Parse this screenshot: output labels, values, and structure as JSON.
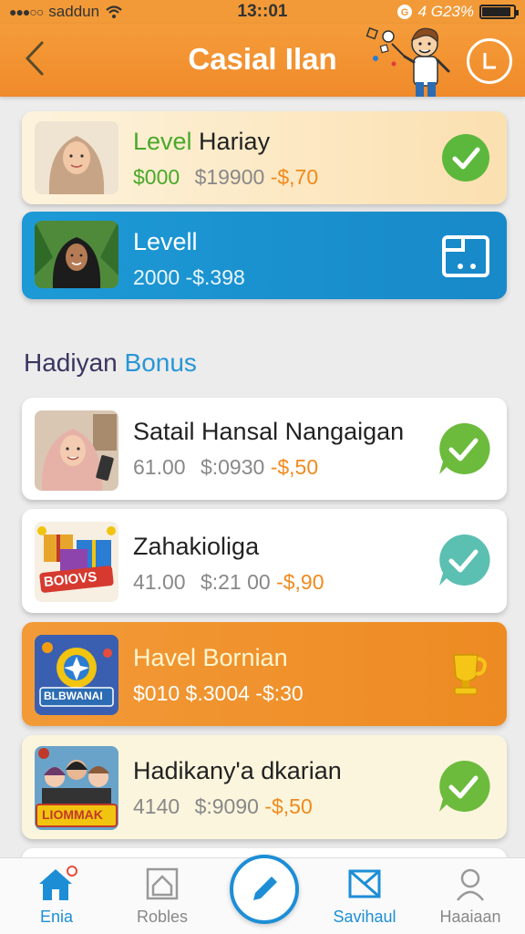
{
  "status": {
    "carrier": "saddun",
    "time": "13::01",
    "right": "4 G23%",
    "battery_level": 0.92
  },
  "header": {
    "title": "Casial Ilan"
  },
  "cards_top": [
    {
      "title_prefix": "Level",
      "title_rest": " Hariay",
      "price_a": "$000",
      "price_b": "$19900",
      "price_c": "-$,70"
    },
    {
      "title": "Levell",
      "prices": "2000 -$.398"
    }
  ],
  "section": {
    "heading_a": "Hadiyan",
    "heading_b": " Bonus"
  },
  "cards": [
    {
      "title": "Satail Hansal Nangaigan",
      "price_a": "61.00",
      "price_b": "$:0930",
      "price_c": "-$,50"
    },
    {
      "title": "Zahakioliga",
      "thumb_label": "BOIOVS",
      "price_a": "41.00",
      "price_b": "$:21 00",
      "price_c": "-$,90"
    },
    {
      "title": "Havel Bornian",
      "thumb_label": "BLBWANAI",
      "prices": "$010  $.3004 -$:30"
    },
    {
      "title": "Hadikany'a dkarian",
      "thumb_label": "LIOMMAK",
      "price_a": "4140",
      "price_b": "$:9090",
      "price_c": "-$,50"
    }
  ],
  "tabs": [
    {
      "label": "Enia"
    },
    {
      "label": "Robles"
    },
    {
      "label": "Savihaul"
    },
    {
      "label": "Haaiaan"
    }
  ],
  "colors": {
    "accent": "#f29a38",
    "blue": "#1d8ed6",
    "check_green": "#5cb83c"
  }
}
